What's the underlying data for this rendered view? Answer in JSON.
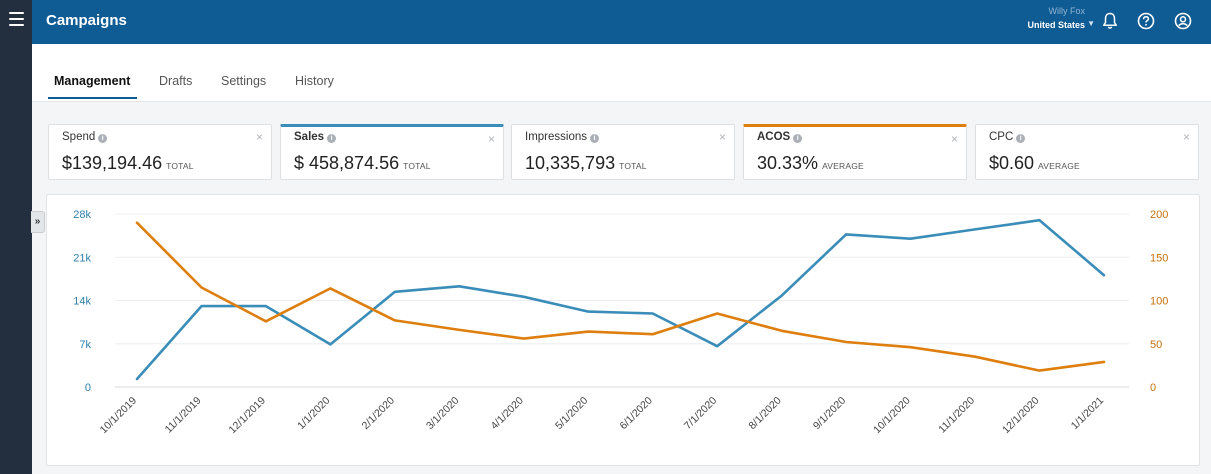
{
  "app": {
    "title": "Campaigns"
  },
  "account": {
    "name": "Willy Fox",
    "country": "United States"
  },
  "icons": {
    "menu": "hamburger-icon",
    "notifications": "bell-icon",
    "help": "question-circle-icon",
    "profile": "user-circle-icon",
    "collapse": "double-chevron-right-icon"
  },
  "rail": {
    "toggle_glyph": "»"
  },
  "tabs": [
    {
      "label": "Management",
      "active": true
    },
    {
      "label": "Drafts",
      "active": false
    },
    {
      "label": "Settings",
      "active": false
    },
    {
      "label": "History",
      "active": false
    }
  ],
  "metrics": [
    {
      "label": "Spend",
      "value": "$139,194.46",
      "suffix": "TOTAL",
      "selected": false
    },
    {
      "label": "Sales",
      "value": "$ 458,874.56",
      "suffix": "TOTAL",
      "selected": true,
      "color": "#3a8db8"
    },
    {
      "label": "Impressions",
      "value": "10,335,793",
      "suffix": "TOTAL",
      "selected": false
    },
    {
      "label": "ACOS",
      "value": "30.33%",
      "suffix": "AVERAGE",
      "selected": true,
      "color": "#de7e0f"
    },
    {
      "label": "CPC",
      "value": "$0.60",
      "suffix": "AVERAGE",
      "selected": false
    }
  ],
  "colors": {
    "brand": "#0f5b94",
    "rail": "#232f3e",
    "sales": "#3a8db8",
    "acos": "#de7e0f"
  },
  "chart_data": {
    "type": "line",
    "x": [
      "10/1/2019",
      "11/1/2019",
      "12/1/2019",
      "1/1/2020",
      "2/1/2020",
      "3/1/2020",
      "4/1/2020",
      "5/1/2020",
      "6/1/2020",
      "7/1/2020",
      "8/1/2020",
      "9/1/2020",
      "10/1/2020",
      "11/1/2020",
      "12/1/2020",
      "1/1/2021"
    ],
    "series": [
      {
        "name": "Sales",
        "axis": "left",
        "color": "#3a8db8",
        "values": [
          1300,
          13100,
          13100,
          6900,
          15400,
          16300,
          14600,
          12200,
          11900,
          6600,
          14800,
          24700,
          24000,
          25500,
          27000,
          18100
        ]
      },
      {
        "name": "ACOS",
        "axis": "right",
        "color": "#de7e0f",
        "values": [
          190,
          115,
          76,
          114,
          77,
          66,
          56,
          64,
          61,
          85,
          65,
          52,
          46,
          35,
          19,
          29
        ]
      }
    ],
    "y_left": {
      "ticks": [
        "28k",
        "21k",
        "14k",
        "7k",
        "0"
      ],
      "ylim": [
        0,
        28000
      ]
    },
    "y_right": {
      "ticks": [
        "200",
        "150",
        "100",
        "50",
        "0"
      ],
      "ylim": [
        0,
        200
      ]
    },
    "grid": true,
    "legend": "none"
  }
}
